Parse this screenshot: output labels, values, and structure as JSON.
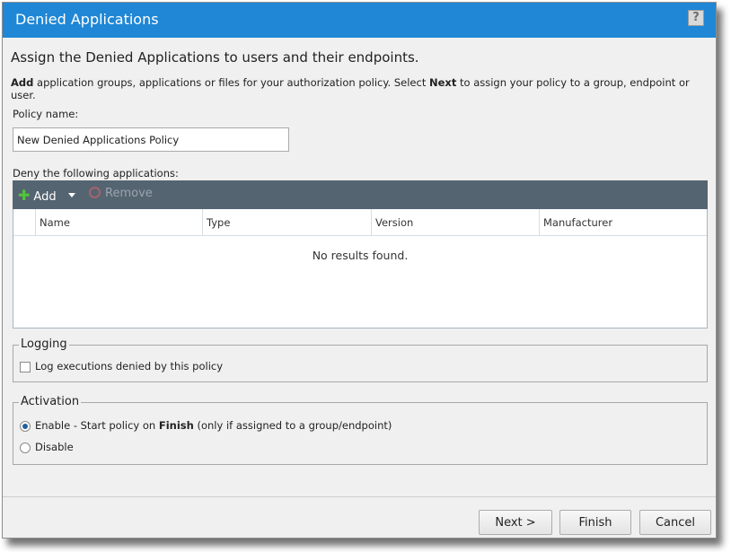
{
  "window": {
    "title": "Denied Applications",
    "help_glyph": "?"
  },
  "heading": "Assign the Denied Applications to users and their endpoints.",
  "instructions": {
    "b1": "Add",
    "t1": " application groups, applications or files for your authorization policy. Select ",
    "b2": "Next",
    "t2": " to assign your policy to a group, endpoint or user."
  },
  "policy": {
    "label": "Policy name:",
    "value": "New Denied Applications Policy"
  },
  "deny": {
    "label": "Deny the following applications:",
    "toolbar": {
      "add": "Add",
      "remove": "Remove"
    },
    "columns": [
      "Name",
      "Type",
      "Version",
      "Manufacturer"
    ],
    "empty": "No results found."
  },
  "logging": {
    "legend": "Logging",
    "checkbox_label": "Log executions denied by this policy",
    "checked": false
  },
  "activation": {
    "legend": "Activation",
    "enable_prefix": "Enable - Start policy on ",
    "enable_bold": "Finish",
    "enable_suffix": " (only if assigned to a group/endpoint)",
    "disable": "Disable",
    "selected": "enable"
  },
  "buttons": {
    "next": "Next >",
    "finish": "Finish",
    "cancel": "Cancel"
  },
  "colors": {
    "title_bar": "#1f87d6",
    "toolbar": "#556471",
    "add_icon": "#52c43a"
  }
}
